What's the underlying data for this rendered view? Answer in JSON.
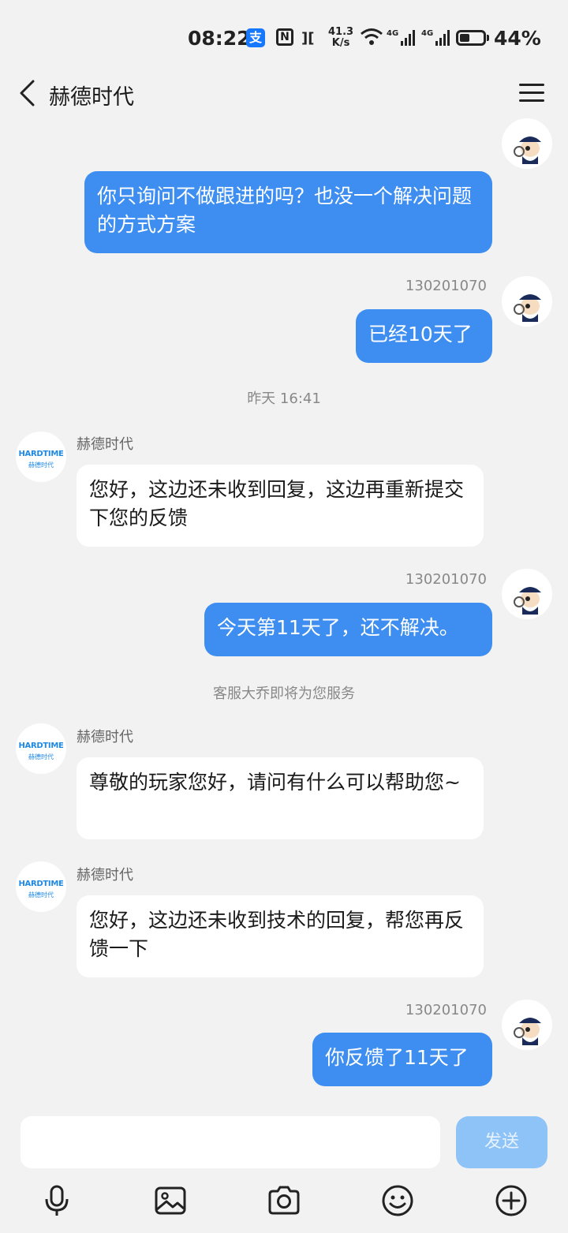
{
  "status_bar": {
    "time": "08:22",
    "alipay": "支",
    "nfc": "N",
    "speed_value": "41.3",
    "speed_unit": "K/s",
    "battery_percent": "44%",
    "battery_level": 0.44
  },
  "header": {
    "title": "赫德时代"
  },
  "chat": {
    "messages": [
      {
        "role": "me",
        "text": "你只询问不做跟进的吗？也没一个解决问题的方式方案"
      },
      {
        "role": "me",
        "uid": "130201070",
        "text": "已经10天了"
      },
      {
        "role": "system",
        "text": "昨天 16:41"
      },
      {
        "role": "them",
        "sender": "赫德时代",
        "text": "您好，这边还未收到回复，这边再重新提交下您的反馈"
      },
      {
        "role": "me",
        "uid": "130201070",
        "text": "今天第11天了，还不解决。"
      },
      {
        "role": "system",
        "text": "客服大乔即将为您服务"
      },
      {
        "role": "them",
        "sender": "赫德时代",
        "text": "尊敬的玩家您好，请问有什么可以帮助您~"
      },
      {
        "role": "them",
        "sender": "赫德时代",
        "text": "您好，这边还未收到技术的回复，帮您再反馈一下"
      },
      {
        "role": "me",
        "uid": "130201070",
        "text": "你反馈了11天了"
      }
    ],
    "brand_logo": "HARDTIME",
    "brand_logo_sub": "赫德时代"
  },
  "input": {
    "value": "",
    "send_label": "发送"
  },
  "toolbar": {
    "icons": [
      "microphone-icon",
      "image-icon",
      "camera-icon",
      "emoji-icon",
      "plus-icon"
    ]
  },
  "colors": {
    "my_bubble": "#3d8ef0",
    "their_bubble": "#ffffff",
    "background": "#f2f2f2",
    "send_button": "#8ec3f7"
  }
}
